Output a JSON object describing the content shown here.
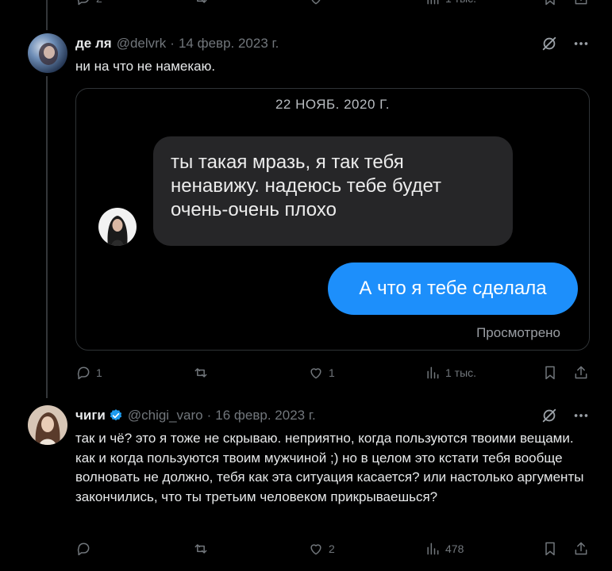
{
  "top_actions": {
    "replies": "2",
    "likes": "",
    "views": "1 тыс."
  },
  "tweet1": {
    "name": "де ля",
    "handle": "@delvrk",
    "date": "14 февр. 2023 г.",
    "text": "ни на что не намекаю.",
    "media": {
      "date_header": "22 НОЯБ. 2020 Г.",
      "incoming_message": "ты такая мразь, я так тебя ненавижу. надеюсь тебе будет очень-очень плохо",
      "outgoing_message": "А что я тебе сделала",
      "read_status": "Просмотрено"
    },
    "actions": {
      "replies": "1",
      "retweets": "",
      "likes": "1",
      "views": "1 тыс."
    }
  },
  "tweet2": {
    "name": "чиги",
    "handle": "@chigi_varo",
    "date": "16 февр. 2023 г.",
    "text": "так и чё? это я тоже не скрываю. неприятно, когда пользуются твоими вещами. как и когда пользуются твоим мужчиной ;) но в целом это кстати тебя вообще волновать не должно, тебя как эта ситуация касается? или настолько аргументы закончились, что ты третьим человеком прикрываешься?",
    "actions": {
      "replies": "",
      "retweets": "",
      "likes": "2",
      "views": "478"
    }
  },
  "colors": {
    "background": "#000000",
    "accent_blue": "#1d9bf0",
    "bubble_gray": "#262628",
    "bubble_blue": "#1d8ffb",
    "muted": "#71767b"
  },
  "icons": [
    "reply-icon",
    "retweet-icon",
    "like-icon",
    "views-icon",
    "bookmark-icon",
    "share-icon",
    "grok-icon",
    "more-icon",
    "verified-icon"
  ]
}
